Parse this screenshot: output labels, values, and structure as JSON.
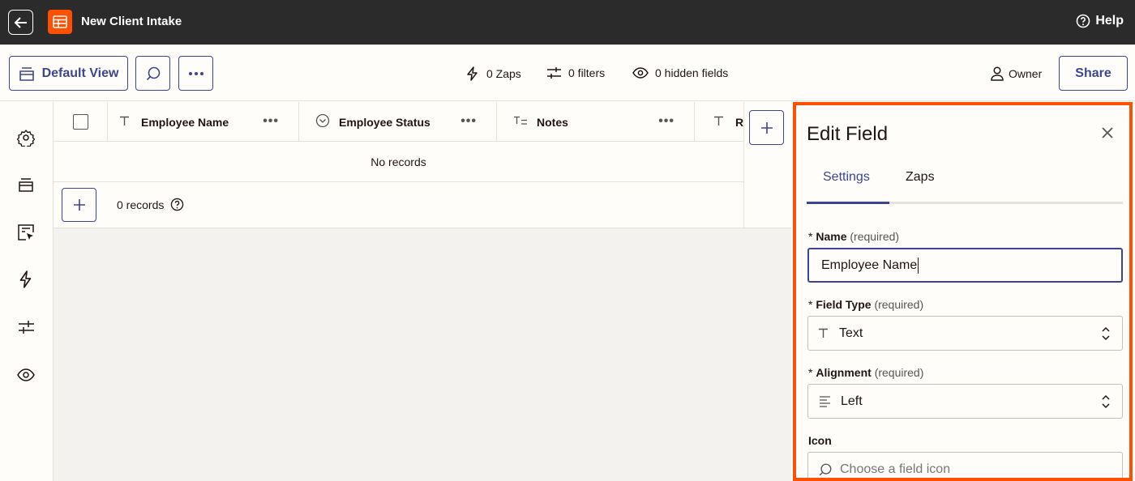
{
  "topbar": {
    "app_title": "New Client Intake",
    "help_label": "Help",
    "back_icon": "arrow-left-icon",
    "app_icon": "table-icon",
    "accent_color": "#ff4f00"
  },
  "toolbar": {
    "default_view_label": "Default View",
    "zaps_label": "0 Zaps",
    "filters_label": "0 filters",
    "hidden_fields_label": "0 hidden fields",
    "owner_label": "Owner",
    "share_label": "Share"
  },
  "grid": {
    "columns": [
      {
        "label": "Employee Name",
        "icon": "text-type-icon"
      },
      {
        "label": "Employee Status",
        "icon": "dropdown-circle-icon"
      },
      {
        "label": "Notes",
        "icon": "long-text-icon"
      },
      {
        "label": "R",
        "icon": "text-type-icon"
      }
    ],
    "empty_message": "No records",
    "records_count": "0 records"
  },
  "edit_field": {
    "title": "Edit Field",
    "tabs": [
      "Settings",
      "Zaps"
    ],
    "active_tab": "Settings",
    "name_label": "Name",
    "name_required": "(required)",
    "name_value": "Employee Name",
    "field_type_label": "Field Type",
    "field_type_required": "(required)",
    "field_type_value": "Text",
    "alignment_label": "Alignment",
    "alignment_required": "(required)",
    "alignment_value": "Left",
    "icon_label": "Icon",
    "icon_placeholder": "Choose a field icon",
    "asterisk": "*"
  },
  "colors": {
    "primary": "#3d4592",
    "highlight_border": "#ff4f00",
    "topbar_bg": "#2b2b2b"
  }
}
